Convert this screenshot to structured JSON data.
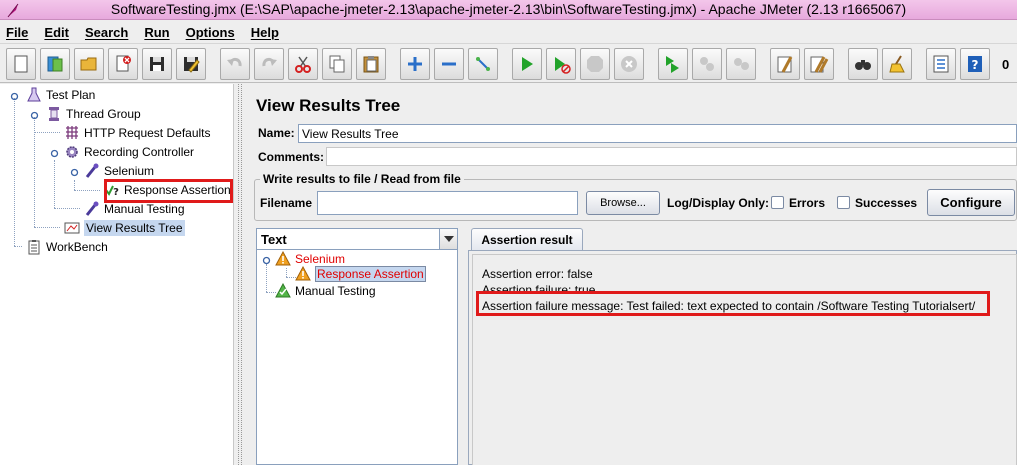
{
  "window": {
    "title": "SoftwareTesting.jmx (E:\\SAP\\apache-jmeter-2.13\\apache-jmeter-2.13\\bin\\SoftwareTesting.jmx) - Apache JMeter (2.13 r1665067)"
  },
  "menu": {
    "items": [
      "File",
      "Edit",
      "Search",
      "Run",
      "Options",
      "Help"
    ]
  },
  "toolbar": {
    "buttons": [
      "new-icon",
      "templates-icon",
      "open-icon",
      "close-icon",
      "save-icon",
      "save-as-icon",
      "undo-icon",
      "redo-icon",
      "cut-icon",
      "copy-icon",
      "paste-icon",
      "expand-icon",
      "collapse-icon",
      "toggle-icon",
      "start-icon",
      "start-no-pauses-icon",
      "stop-icon",
      "shutdown-icon",
      "remote-start-icon",
      "remote-stop-icon",
      "remote-shutdown-icon",
      "clear-icon",
      "clear-all-icon",
      "search-icon",
      "reset-search-icon",
      "function-helper-icon",
      "help-icon"
    ],
    "counter": "0"
  },
  "tree": {
    "test_plan": "Test Plan",
    "thread_group": "Thread Group",
    "http_defaults": "HTTP Request Defaults",
    "recording_controller": "Recording Controller",
    "selenium": "Selenium",
    "response_assertion": "Response Assertion",
    "manual_testing": "Manual Testing",
    "view_results_tree": "View Results Tree",
    "workbench": "WorkBench"
  },
  "main": {
    "title": "View Results Tree",
    "name_label": "Name:",
    "name_value": "View Results Tree",
    "comments_label": "Comments:",
    "file_group_title": "Write results to file / Read from file",
    "filename_label": "Filename",
    "filename_value": "",
    "browse_label": "Browse...",
    "log_display_label": "Log/Display Only:",
    "errors_label": "Errors",
    "successes_label": "Successes",
    "configure_label": "Configure"
  },
  "results": {
    "renderer": "Text",
    "samples": {
      "selenium": "Selenium",
      "response_assertion": "Response Assertion",
      "manual_testing": "Manual Testing"
    },
    "tab_label": "Assertion result",
    "lines": {
      "error": "Assertion error: false",
      "failure": "Assertion failure: true",
      "message": "Assertion failure message: Test failed: text expected to contain /Software Testing Tutorialsert/"
    }
  },
  "colors": {
    "highlight_box": "#e01a1a",
    "failed_sample_text": "#e00000",
    "selection": "#c5d7ef"
  }
}
